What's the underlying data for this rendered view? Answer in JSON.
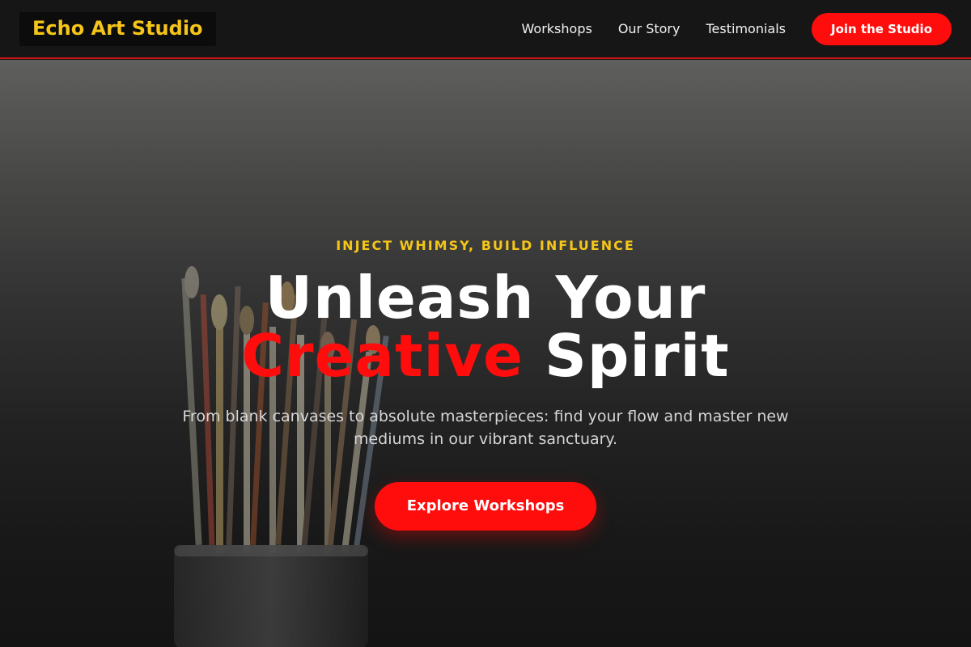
{
  "header": {
    "logo": "Echo Art Studio",
    "nav": [
      {
        "label": "Workshops"
      },
      {
        "label": "Our Story"
      },
      {
        "label": "Testimonials"
      }
    ],
    "cta_label": "Join the Studio"
  },
  "hero": {
    "eyebrow": "INJECT WHIMSY, BUILD INFLUENCE",
    "headline_line1": "Unleash Your",
    "headline_accent": "Creative",
    "headline_rest": "Spirit",
    "subtext": "From blank canvases to absolute masterpieces: find your flow and master new mediums in our vibrant sanctuary.",
    "cta_label": "Explore Workshops",
    "background_image": "paintbrushes-in-jar"
  },
  "colors": {
    "brand_yellow": "#f5c518",
    "accent_red": "#ff0d0d",
    "header_bg": "#161616"
  }
}
